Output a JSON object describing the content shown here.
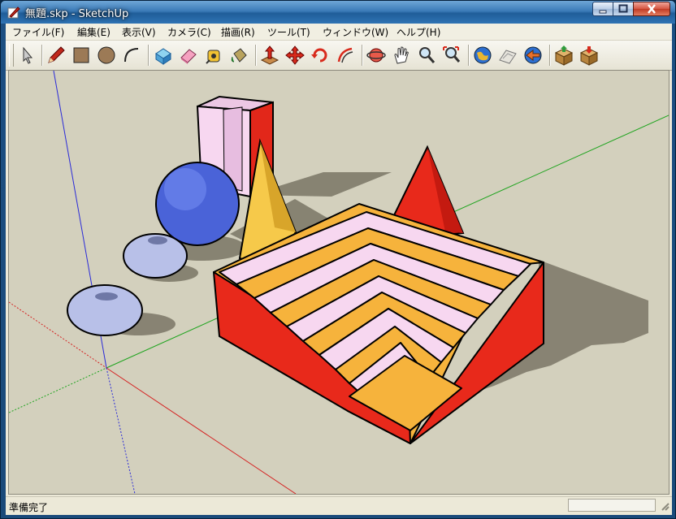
{
  "window": {
    "title": "無題.skp - SketchUp"
  },
  "menu": [
    {
      "label": "ファイル(F)"
    },
    {
      "label": "編集(E)"
    },
    {
      "label": "表示(V)"
    },
    {
      "label": "カメラ(C)"
    },
    {
      "label": "描画(R)"
    },
    {
      "label": "ツール(T)"
    },
    {
      "label": "ウィンドウ(W)"
    },
    {
      "label": "ヘルプ(H)"
    }
  ],
  "toolbar": {
    "tools": [
      {
        "name": "select-tool",
        "icon": "arrow-icon"
      },
      {
        "name": "line-tool",
        "icon": "pencil-icon"
      },
      {
        "name": "rectangle-tool",
        "icon": "rectangle-icon"
      },
      {
        "name": "circle-tool",
        "icon": "circle-icon"
      },
      {
        "name": "arc-tool",
        "icon": "arc-icon"
      },
      {
        "name": "make-component-tool",
        "icon": "component-icon"
      },
      {
        "name": "eraser-tool",
        "icon": "eraser-icon"
      },
      {
        "name": "tape-measure-tool",
        "icon": "tape-measure-icon"
      },
      {
        "name": "paint-bucket-tool",
        "icon": "paint-bucket-icon"
      },
      {
        "name": "push-pull-tool",
        "icon": "push-pull-icon"
      },
      {
        "name": "move-tool",
        "icon": "move-icon"
      },
      {
        "name": "rotate-tool",
        "icon": "rotate-icon"
      },
      {
        "name": "offset-tool",
        "icon": "offset-icon"
      },
      {
        "name": "orbit-tool",
        "icon": "orbit-icon"
      },
      {
        "name": "pan-tool",
        "icon": "hand-icon"
      },
      {
        "name": "zoom-tool",
        "icon": "magnifier-icon"
      },
      {
        "name": "zoom-extents-tool",
        "icon": "zoom-extents-icon"
      },
      {
        "name": "google-earth-tool",
        "icon": "earth-icon"
      },
      {
        "name": "get-current-view-tool",
        "icon": "terrain-icon"
      },
      {
        "name": "place-model-tool",
        "icon": "place-model-icon"
      },
      {
        "name": "get-models-tool",
        "icon": "box-icon"
      },
      {
        "name": "share-model-tool",
        "icon": "share-box-icon"
      }
    ]
  },
  "status": {
    "text": "準備完了",
    "value": ""
  },
  "colors": {
    "background": "#d3d0bd",
    "red": "#e8291b",
    "orange": "#f6b33c",
    "pink": "#f7d7f0",
    "blue": "#4a63d8"
  }
}
